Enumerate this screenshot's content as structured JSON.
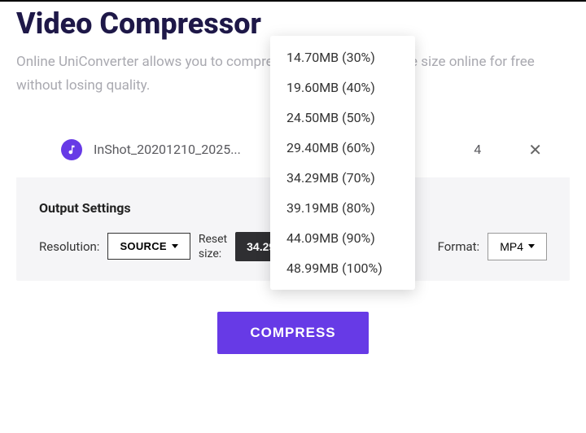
{
  "title": "Video Compressor",
  "subtitle": "Online UniConverter allows you to compress and reduce video file size online for free without losing quality.",
  "file": {
    "name": "InShot_20201210_2025...",
    "size_partial": "4",
    "icon_name": "music-note-icon"
  },
  "output": {
    "heading": "Output Settings",
    "resolution_label": "Resolution:",
    "source_label": "SOURCE",
    "reset_line1": "Reset",
    "reset_line2": "size:",
    "selected_size": "34.29MB (70%)",
    "format_label": "Format:",
    "format_value": "MP4"
  },
  "size_options": [
    "14.70MB (30%)",
    "19.60MB (40%)",
    "24.50MB (50%)",
    "29.40MB (60%)",
    "34.29MB (70%)",
    "39.19MB (80%)",
    "44.09MB (90%)",
    "48.99MB (100%)"
  ],
  "compress_label": "COMPRESS"
}
